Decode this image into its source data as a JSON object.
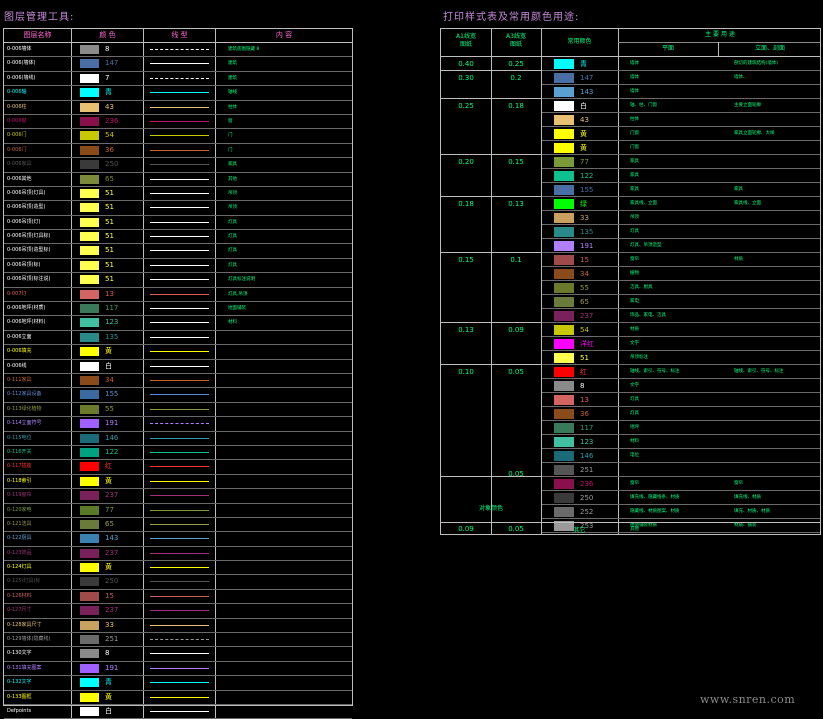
{
  "titles": {
    "left": "图层管理工具:",
    "right": "打印样式表及常用颜色用途:"
  },
  "layer_table": {
    "headers": [
      "图层名称",
      "颜 色",
      "线 型",
      "内 容"
    ],
    "rows": [
      {
        "name": "0-006墙体",
        "name_color": "#ffffff",
        "swatch": "#8a8a8a",
        "num": "8",
        "num_color": "#ffffff",
        "line": "dash",
        "line_color": "#ffffff",
        "note": "建筑底图隐藏 8"
      },
      {
        "name": "0-006(墙体)",
        "name_color": "#ffffff",
        "swatch": "#4a6fa5",
        "num": "147",
        "num_color": "#4a6fa5",
        "line": "solid",
        "line_color": "#ffffff",
        "note": "建筑"
      },
      {
        "name": "0-006(墙线)",
        "name_color": "#ffffff",
        "swatch": "#ffffff",
        "num": "7",
        "num_color": "#ffffff",
        "line": "dash",
        "line_color": "#ffffff",
        "note": "建筑"
      },
      {
        "name": "0-006轴",
        "name_color": "#00ffff",
        "swatch": "#00ffff",
        "num": "青",
        "num_color": "#00ffff",
        "line": "solid",
        "line_color": "#00ffff",
        "note": "轴线"
      },
      {
        "name": "0-006柱",
        "name_color": "#e8c071",
        "swatch": "#e8c071",
        "num": "43",
        "num_color": "#e8c071",
        "line": "solid",
        "line_color": "#e8c071",
        "note": "柱体"
      },
      {
        "name": "0-006窗",
        "name_color": "#c0116a",
        "swatch": "#8a0f4d",
        "num": "236",
        "num_color": "#c0116a",
        "line": "solid",
        "line_color": "#c0116a",
        "note": "窗"
      },
      {
        "name": "0-006门",
        "name_color": "#c8c800",
        "swatch": "#c8c800",
        "num": "54",
        "num_color": "#c8c800",
        "line": "solid",
        "line_color": "#c8c800",
        "note": "门"
      },
      {
        "name": "0-006门",
        "name_color": "#c86428",
        "swatch": "#8a4a1a",
        "num": "36",
        "num_color": "#c86428",
        "line": "solid",
        "line_color": "#c86428",
        "note": "门"
      },
      {
        "name": "0-006家具",
        "name_color": "#555555",
        "swatch": "#3a3a3a",
        "num": "250",
        "num_color": "#555555",
        "line": "solid",
        "line_color": "#555555",
        "note": "家具"
      },
      {
        "name": "0-006其他",
        "name_color": "#ffffff",
        "swatch": "#7a8a3a",
        "num": "65",
        "num_color": "#7a8a3a",
        "line": "solid",
        "line_color": "#ffffff",
        "note": "其他"
      },
      {
        "name": "0-006吊顶(灯具)",
        "name_color": "#ffffff",
        "swatch": "#ffff50",
        "num": "51",
        "num_color": "#ffff50",
        "line": "solid",
        "line_color": "#ffffff",
        "note": "吊顶"
      },
      {
        "name": "0-006吊顶(造型)",
        "name_color": "#ffffff",
        "swatch": "#ffff50",
        "num": "51",
        "num_color": "#ffff50",
        "line": "solid",
        "line_color": "#ffffff",
        "note": "吊顶"
      },
      {
        "name": "0-006吊顶(灯)",
        "name_color": "#ffffff",
        "swatch": "#ffff50",
        "num": "51",
        "num_color": "#ffff50",
        "line": "solid",
        "line_color": "#ffffff",
        "note": "灯具"
      },
      {
        "name": "0-006吊顶(灯具标)",
        "name_color": "#ffffff",
        "swatch": "#ffff50",
        "num": "51",
        "num_color": "#ffff50",
        "line": "solid",
        "line_color": "#ffffff",
        "note": "灯具"
      },
      {
        "name": "0-006吊顶(造型标)",
        "name_color": "#ffffff",
        "swatch": "#ffff50",
        "num": "51",
        "num_color": "#ffff50",
        "line": "solid",
        "line_color": "#ffffff",
        "note": "灯具"
      },
      {
        "name": "0-006吊顶(标)",
        "name_color": "#ffffff",
        "swatch": "#ffff50",
        "num": "51",
        "num_color": "#ffff50",
        "line": "solid",
        "line_color": "#ffffff",
        "note": "灯具"
      },
      {
        "name": "0-006吊顶(标注说)",
        "name_color": "#ffffff",
        "swatch": "#ffff50",
        "num": "51",
        "num_color": "#ffff50",
        "line": "solid",
        "line_color": "#ffffff",
        "note": "灯具标注说明"
      },
      {
        "name": "0-007灯",
        "name_color": "#e05a5a",
        "swatch": "#d26464",
        "num": "13",
        "num_color": "#e05a5a",
        "line": "solid",
        "line_color": "#e05a5a",
        "note": "灯具,吊顶"
      },
      {
        "name": "0-006地坪(材质)",
        "name_color": "#ffffff",
        "swatch": "#3a7a5a",
        "num": "117",
        "num_color": "#3a9a6a",
        "line": "solid",
        "line_color": "#ffffff",
        "note": "地面铺装"
      },
      {
        "name": "0-006地坪(材料)",
        "name_color": "#ffffff",
        "swatch": "#40c0a0",
        "num": "123",
        "num_color": "#40c0a0",
        "line": "solid",
        "line_color": "#ffffff",
        "note": "材料"
      },
      {
        "name": "0-006立面",
        "name_color": "#ffffff",
        "swatch": "#2a8a8a",
        "num": "135",
        "num_color": "#2a8a8a",
        "line": "solid",
        "line_color": "#ffffff",
        "note": ""
      },
      {
        "name": "0-006填充",
        "name_color": "#ffff00",
        "swatch": "#ffff00",
        "num": "黄",
        "num_color": "#ffff00",
        "line": "solid",
        "line_color": "#ffff00",
        "note": ""
      },
      {
        "name": "0-006线",
        "name_color": "#ffffff",
        "swatch": "#ffffff",
        "num": "白",
        "num_color": "#ffffff",
        "line": "solid",
        "line_color": "#ffffff",
        "note": ""
      },
      {
        "name": "0-111家具",
        "name_color": "#c86428",
        "swatch": "#8a4a1a",
        "num": "34",
        "num_color": "#c86428",
        "line": "solid",
        "line_color": "#c86428",
        "note": ""
      },
      {
        "name": "0-112家具设备",
        "name_color": "#5a8ad0",
        "swatch": "#3a6aa0",
        "num": "155",
        "num_color": "#5a8ad0",
        "line": "solid",
        "line_color": "#5a8ad0",
        "note": ""
      },
      {
        "name": "0-113绿化植物",
        "name_color": "#8a9a3a",
        "swatch": "#6a7a2a",
        "num": "55",
        "num_color": "#8a9a3a",
        "line": "solid",
        "line_color": "#8a9a3a",
        "note": ""
      },
      {
        "name": "0-114立面符号",
        "name_color": "#b080ff",
        "swatch": "#a060ff",
        "num": "191",
        "num_color": "#b080ff",
        "line": "dash",
        "line_color": "#b080ff",
        "note": ""
      },
      {
        "name": "0-115电位",
        "name_color": "#2a9aaa",
        "swatch": "#1a6a7a",
        "num": "146",
        "num_color": "#2a9aaa",
        "line": "solid",
        "line_color": "#2a9aaa",
        "note": ""
      },
      {
        "name": "0-116开关",
        "name_color": "#10c090",
        "swatch": "#00a080",
        "num": "122",
        "num_color": "#10c090",
        "line": "solid",
        "line_color": "#10c090",
        "note": ""
      },
      {
        "name": "0-117插座",
        "name_color": "#ff3030",
        "swatch": "#ff0000",
        "num": "红",
        "num_color": "#ff3030",
        "line": "solid",
        "line_color": "#ff3030",
        "note": ""
      },
      {
        "name": "0-118索引",
        "name_color": "#ffff00",
        "swatch": "#ffff00",
        "num": "黄",
        "num_color": "#ffff00",
        "line": "solid",
        "line_color": "#ffff00",
        "note": ""
      },
      {
        "name": "0-119窗帘",
        "name_color": "#a0307a",
        "swatch": "#7a205a",
        "num": "237",
        "num_color": "#a0307a",
        "line": "solid",
        "line_color": "#a0307a",
        "note": ""
      },
      {
        "name": "0-120家电",
        "name_color": "#7a9a3a",
        "swatch": "#5a7a2a",
        "num": "77",
        "num_color": "#7a9a3a",
        "line": "solid",
        "line_color": "#7a9a3a",
        "note": ""
      },
      {
        "name": "0-121洁具",
        "name_color": "#9a9a4a",
        "swatch": "#6a7a3a",
        "num": "65",
        "num_color": "#9a9a4a",
        "line": "solid",
        "line_color": "#9a9a4a",
        "note": ""
      },
      {
        "name": "0-122厨具",
        "name_color": "#5aa0d0",
        "swatch": "#3a80b0",
        "num": "143",
        "num_color": "#5aa0d0",
        "line": "solid",
        "line_color": "#5aa0d0",
        "note": ""
      },
      {
        "name": "0-123饰品",
        "name_color": "#a0307a",
        "swatch": "#7a205a",
        "num": "237",
        "num_color": "#a0307a",
        "line": "solid",
        "line_color": "#a0307a",
        "note": ""
      },
      {
        "name": "0-124灯具",
        "name_color": "#ffff00",
        "swatch": "#ffff00",
        "num": "黄",
        "num_color": "#ffff00",
        "line": "solid",
        "line_color": "#ffff00",
        "note": ""
      },
      {
        "name": "0-125(灯具)标",
        "name_color": "#555555",
        "swatch": "#3a3a3a",
        "num": "250",
        "num_color": "#555555",
        "line": "solid",
        "line_color": "#555555",
        "note": ""
      },
      {
        "name": "0-126材料",
        "name_color": "#c86060",
        "swatch": "#a04a4a",
        "num": "15",
        "num_color": "#c86060",
        "line": "solid",
        "line_color": "#c86060",
        "note": ""
      },
      {
        "name": "0-127尺寸",
        "name_color": "#a0307a",
        "swatch": "#7a205a",
        "num": "237",
        "num_color": "#a0307a",
        "line": "solid",
        "line_color": "#a0307a",
        "note": ""
      },
      {
        "name": "0-128家具尺寸",
        "name_color": "#e8c071",
        "swatch": "#c8a060",
        "num": "33",
        "num_color": "#e8c071",
        "line": "solid",
        "line_color": "#e8c071",
        "note": ""
      },
      {
        "name": "0-129墙体(隐藏线)",
        "name_color": "#9a9a9a",
        "swatch": "#6a6a6a",
        "num": "251",
        "num_color": "#9a9a9a",
        "line": "dash",
        "line_color": "#9a9a9a",
        "note": ""
      },
      {
        "name": "0-130文字",
        "name_color": "#ffffff",
        "swatch": "#8a8a8a",
        "num": "8",
        "num_color": "#ffffff",
        "line": "solid",
        "line_color": "#ffffff",
        "note": ""
      },
      {
        "name": "0-131填充图案",
        "name_color": "#b080ff",
        "swatch": "#a060ff",
        "num": "191",
        "num_color": "#b080ff",
        "line": "solid",
        "line_color": "#b080ff",
        "note": ""
      },
      {
        "name": "0-132文字",
        "name_color": "#00ffff",
        "swatch": "#00ffff",
        "num": "青",
        "num_color": "#00ffff",
        "line": "solid",
        "line_color": "#00ffff",
        "note": ""
      },
      {
        "name": "0-133图框",
        "name_color": "#ffff00",
        "swatch": "#ffff00",
        "num": "黄",
        "num_color": "#ffff00",
        "line": "solid",
        "line_color": "#ffff00",
        "note": ""
      },
      {
        "name": "Defpoints",
        "name_color": "#ffffff",
        "swatch": "#ffffff",
        "num": "白",
        "num_color": "#ffffff",
        "line": "solid",
        "line_color": "#ffffff",
        "note": ""
      }
    ]
  },
  "print_table": {
    "headers": {
      "a1": "A1线宽\n图纸",
      "a3": "A3线宽\n图纸",
      "color": "常用颜色",
      "use": "主 要 用 途",
      "plan": "平面",
      "elev": "立面、剖面"
    },
    "groups": [
      {
        "a1": "0.40",
        "a3": "0.25",
        "rows": 1
      },
      {
        "a1": "0.30",
        "a3": "0.2",
        "rows": 2
      },
      {
        "a1": "0.25",
        "a3": "0.18",
        "rows": 4
      },
      {
        "a1": "0.20",
        "a3": "0.15",
        "rows": 3
      },
      {
        "a1": "0.18",
        "a3": "0.13",
        "rows": 4
      },
      {
        "a1": "0.15",
        "a3": "0.1",
        "rows": 5
      },
      {
        "a1": "0.13",
        "a3": "0.09",
        "rows": 3
      },
      {
        "a1": "0.10",
        "a3": "0.05",
        "rows": 8
      }
    ],
    "rows": [
      {
        "swatch": "#00ffff",
        "num": "青",
        "num_color": "#00ffff",
        "plan": "墙体",
        "elev": "剖切的建筑结构(墙体)"
      },
      {
        "swatch": "#4a6fa5",
        "num": "147",
        "num_color": "#4a6fa5",
        "plan": "墙体",
        "elev": "墙体、"
      },
      {
        "swatch": "#5aa0d0",
        "num": "143",
        "num_color": "#5aa0d0",
        "plan": "墙体",
        "elev": ""
      },
      {
        "swatch": "#ffffff",
        "num": "白",
        "num_color": "#ffffff",
        "plan": "轴、柱、门窗",
        "elev": "主要立面轮廓"
      },
      {
        "swatch": "#e8c071",
        "num": "43",
        "num_color": "#e8c071",
        "plan": "柱体",
        "elev": ""
      },
      {
        "swatch": "#ffff00",
        "num": "黄",
        "num_color": "#ffff00",
        "plan": "门窗",
        "elev": "家具立面轮廓、大样"
      },
      {
        "swatch": "#ffff00",
        "num": "黄",
        "num_color": "#ffff00",
        "plan": "门窗",
        "elev": ""
      },
      {
        "swatch": "#7a9a3a",
        "num": "77",
        "num_color": "#7a9a3a",
        "plan": "家具",
        "elev": ""
      },
      {
        "swatch": "#10c090",
        "num": "122",
        "num_color": "#10c090",
        "plan": "家具",
        "elev": ""
      },
      {
        "swatch": "#4a6fa5",
        "num": "155",
        "num_color": "#4a6fa5",
        "plan": "家具",
        "elev": "家具"
      },
      {
        "swatch": "#00ff00",
        "num": "绿",
        "num_color": "#00ff00",
        "plan": "家具线、立面",
        "elev": "家具线、立面"
      },
      {
        "swatch": "#c8a060",
        "num": "33",
        "num_color": "#c8a060",
        "plan": "吊顶",
        "elev": ""
      },
      {
        "swatch": "#2a8a8a",
        "num": "135",
        "num_color": "#2a8a8a",
        "plan": "灯具",
        "elev": ""
      },
      {
        "swatch": "#b080ff",
        "num": "191",
        "num_color": "#b080ff",
        "plan": "灯具、吊顶造型",
        "elev": ""
      },
      {
        "swatch": "#a04a4a",
        "num": "15",
        "num_color": "#c86060",
        "plan": "窗帘",
        "elev": "材质"
      },
      {
        "swatch": "#8a4a1a",
        "num": "34",
        "num_color": "#c86428",
        "plan": "植物",
        "elev": ""
      },
      {
        "swatch": "#6a7a2a",
        "num": "55",
        "num_color": "#8a9a3a",
        "plan": "洁具、厨具",
        "elev": ""
      },
      {
        "swatch": "#6a7a3a",
        "num": "65",
        "num_color": "#9a9a4a",
        "plan": "家电",
        "elev": ""
      },
      {
        "swatch": "#7a205a",
        "num": "237",
        "num_color": "#a0307a",
        "plan": "饰品、家电、洁具",
        "elev": ""
      },
      {
        "swatch": "#c8c800",
        "num": "54",
        "num_color": "#c8c800",
        "plan": "材质",
        "elev": ""
      },
      {
        "swatch": "#ff00ff",
        "num": "洋红",
        "num_color": "#ff00ff",
        "plan": "文字",
        "elev": ""
      },
      {
        "swatch": "#ffff50",
        "num": "51",
        "num_color": "#ffff50",
        "plan": "吊顶标注",
        "elev": ""
      },
      {
        "swatch": "#ff0000",
        "num": "红",
        "num_color": "#ff3030",
        "plan": "轴线、索引、符号、标注",
        "elev": "轴线、索引、符号、标注"
      },
      {
        "swatch": "#8a8a8a",
        "num": "8",
        "num_color": "#ffffff",
        "plan": "文字",
        "elev": ""
      },
      {
        "swatch": "#d26464",
        "num": "13",
        "num_color": "#e05a5a",
        "plan": "灯具",
        "elev": ""
      },
      {
        "swatch": "#8a4a1a",
        "num": "36",
        "num_color": "#c86428",
        "plan": "灯具",
        "elev": ""
      },
      {
        "swatch": "#3a7a5a",
        "num": "117",
        "num_color": "#3a9a6a",
        "plan": "地坪",
        "elev": ""
      },
      {
        "swatch": "#40c0a0",
        "num": "123",
        "num_color": "#40c0a0",
        "plan": "材料",
        "elev": ""
      },
      {
        "swatch": "#1a6a7a",
        "num": "146",
        "num_color": "#2a9aaa",
        "plan": "电位",
        "elev": ""
      },
      {
        "swatch": "#555555",
        "num": "251",
        "num_color": "#9a9a9a",
        "plan": "",
        "elev": ""
      },
      {
        "swatch": "#8a0f4d",
        "num": "236",
        "num_color": "#c0116a",
        "plan": "窗帘",
        "elev": "窗帘"
      },
      {
        "swatch": "#3a3a3a",
        "num": "250",
        "num_color": "#9a9a9a",
        "plan": "填充线、隐藏线条、材质",
        "elev": "填充线、材质"
      },
      {
        "swatch": "#6a6a6a",
        "num": "252",
        "num_color": "#9a9a9a",
        "plan": "隐藏线、材质图案、材质",
        "elev": "填充、材质、材质"
      },
      {
        "swatch": "#9a9a9a",
        "num": "253",
        "num_color": "#9a9a9a",
        "plan": "地面铺装材质",
        "elev": "材质、铺装"
      }
    ],
    "extra": {
      "a3_005": "0.05",
      "special_label": "对象颜色",
      "bottom_a1": "0.09",
      "bottom_a3": "0.05",
      "bottom_label": "其它",
      "bottom_plan": "其他"
    }
  },
  "watermark": "www.snren.com"
}
